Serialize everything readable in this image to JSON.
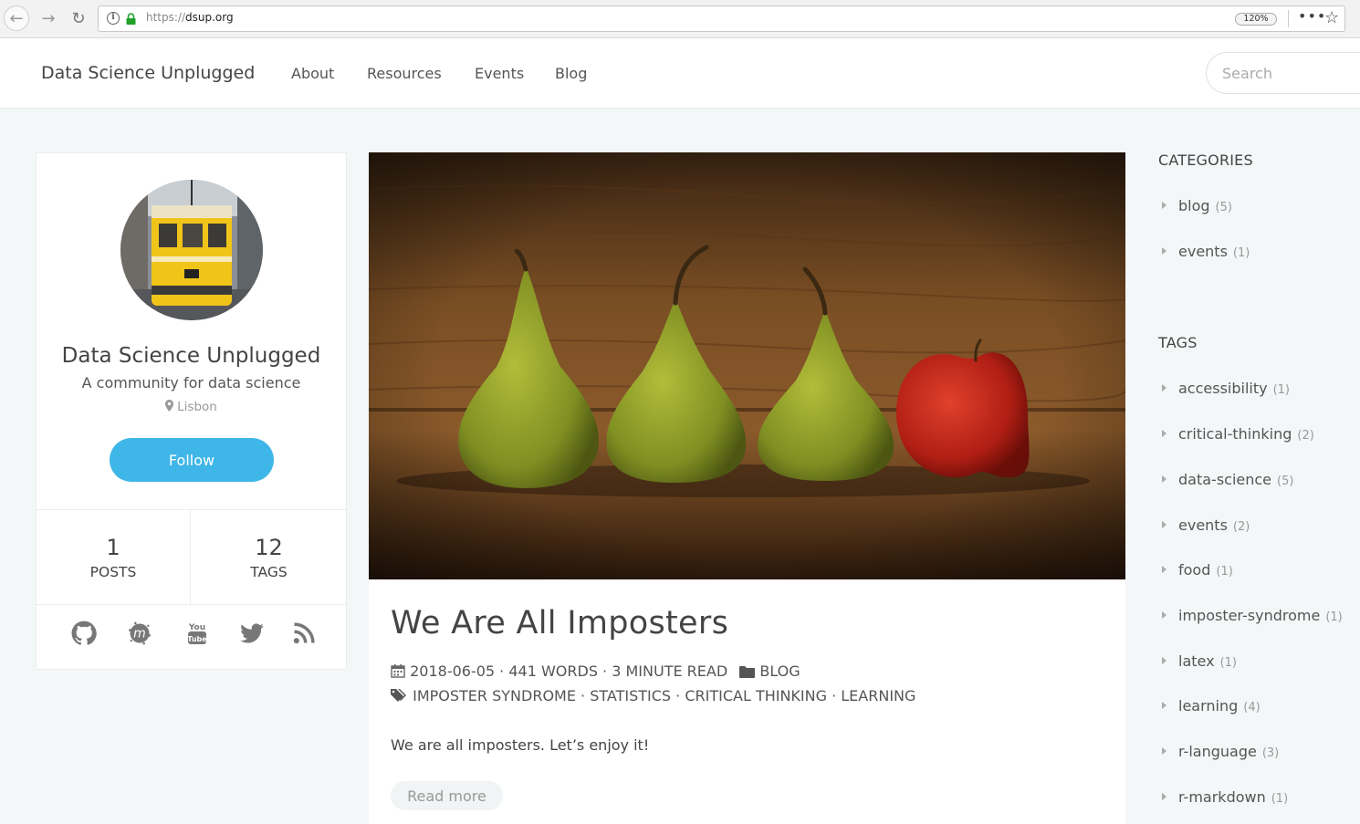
{
  "browser": {
    "url_protocol": "https://",
    "url_domain": "dsup.org",
    "zoom": "120%",
    "more_glyph": "•••",
    "star_glyph": "☆",
    "back_glyph": "←",
    "forward_glyph": "→",
    "reload_glyph": "↻",
    "info_glyph": "i"
  },
  "header": {
    "brand": "Data Science Unplugged",
    "menu": [
      "About",
      "Resources",
      "Events",
      "Blog"
    ],
    "search_placeholder": "Search"
  },
  "profile": {
    "name": "Data Science Unplugged",
    "subtitle": "A community for data science",
    "location": "Lisbon",
    "follow_label": "Follow",
    "stats": [
      {
        "value": "1",
        "label": "POSTS"
      },
      {
        "value": "12",
        "label": "TAGS"
      }
    ],
    "socials": [
      "github-icon",
      "meetup-icon",
      "youtube-icon",
      "twitter-icon",
      "rss-icon"
    ]
  },
  "post": {
    "title": "We Are All Imposters",
    "meta_line": "2018-06-05 · 441 WORDS · 3 MINUTE READ",
    "category": "BLOG",
    "tags": "IMPOSTER SYNDROME · STATISTICS · CRITICAL THINKING · LEARNING",
    "excerpt": "We are all imposters. Let’s enjoy it!",
    "read_more": "Read more"
  },
  "sidebar": {
    "categories_title": "CATEGORIES",
    "categories": [
      {
        "name": "blog",
        "count": "(5)"
      },
      {
        "name": "events",
        "count": "(1)"
      }
    ],
    "tags_title": "TAGS",
    "tags": [
      {
        "name": "accessibility",
        "count": "(1)"
      },
      {
        "name": "critical-thinking",
        "count": "(2)"
      },
      {
        "name": "data-science",
        "count": "(5)"
      },
      {
        "name": "events",
        "count": "(2)"
      },
      {
        "name": "food",
        "count": "(1)"
      },
      {
        "name": "imposter-syndrome",
        "count": "(1)"
      },
      {
        "name": "latex",
        "count": "(1)"
      },
      {
        "name": "learning",
        "count": "(4)"
      },
      {
        "name": "r-language",
        "count": "(3)"
      },
      {
        "name": "r-markdown",
        "count": "(1)"
      }
    ]
  },
  "colors": {
    "accent": "#3fb6e8",
    "page_bg": "#f4f7f8"
  }
}
